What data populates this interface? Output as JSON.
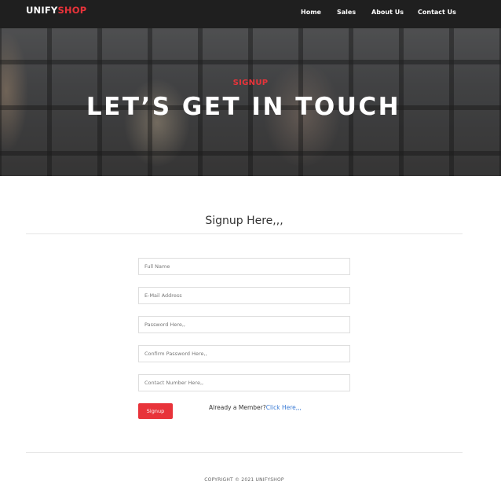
{
  "brand": {
    "part1": "UNIFY",
    "part2": "SHOP"
  },
  "nav": {
    "items": [
      {
        "label": "Home"
      },
      {
        "label": "Sales"
      },
      {
        "label": "About Us"
      },
      {
        "label": "Contact Us"
      }
    ]
  },
  "hero": {
    "subtitle": "SIGNUP",
    "title": "LET’S GET IN TOUCH"
  },
  "signup": {
    "heading": "Signup Here,,,",
    "fields": [
      {
        "placeholder": "Full Name"
      },
      {
        "placeholder": "E-Mail Address"
      },
      {
        "placeholder": "Password Here,,"
      },
      {
        "placeholder": "Confirm Password Here,,"
      },
      {
        "placeholder": "Contact Number Here,,"
      }
    ],
    "button_label": "Signup",
    "member_text": "Already a Member?",
    "member_link": "Click Here,,,"
  },
  "footer": {
    "copyright": "COPYRIGHT © 2021 UNIFYSHOP"
  },
  "colors": {
    "accent": "#e8333a",
    "navbar": "#1f1f1f",
    "link": "#3a7bd5"
  }
}
